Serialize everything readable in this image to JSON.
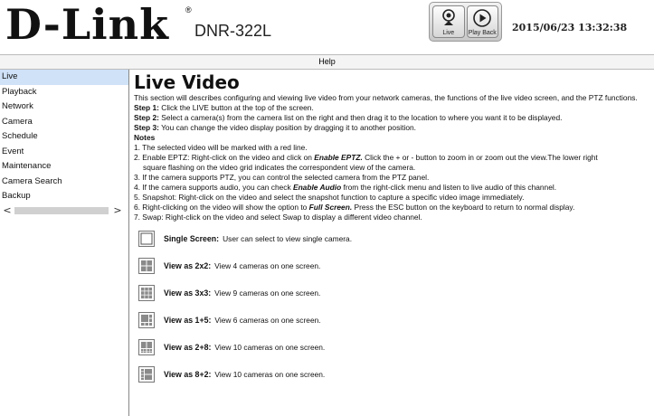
{
  "header": {
    "logo_text": "D-Link",
    "logo_reg": "®",
    "model": "DNR-322L",
    "live_label": "Live",
    "playback_label": "Play Back",
    "datetime": "2015/06/23 13:32:38"
  },
  "helpbar": {
    "label": "Help"
  },
  "sidebar": {
    "items": [
      {
        "label": "Live",
        "active": true
      },
      {
        "label": "Playback"
      },
      {
        "label": "Network"
      },
      {
        "label": "Camera"
      },
      {
        "label": "Schedule"
      },
      {
        "label": "Event"
      },
      {
        "label": "Maintenance"
      },
      {
        "label": "Camera Search"
      },
      {
        "label": "Backup"
      }
    ],
    "scroll_left": "<",
    "scroll_right": ">"
  },
  "content": {
    "title": "Live Video",
    "intro": "This section will describes configuring and viewing live video from your network cameras, the functions of the live video screen, and the PTZ functions.",
    "steps": [
      {
        "label": "Step 1:",
        "text": " Click the LIVE button at the top of the screen."
      },
      {
        "label": "Step 2:",
        "text": " Select a camera(s) from the camera list on the right and then drag it to the location to where you want it to be displayed."
      },
      {
        "label": "Step 3:",
        "text": " You can change the video display position by dragging it to another position."
      }
    ],
    "notes_title": "Notes",
    "notes": {
      "n1": "1. The selected video will be marked with a red line.",
      "n2_a": "2. Enable EPTZ: Right-click on the video and click on ",
      "n2_b": "Enable EPTZ.",
      "n2_c": " Click the + or - button to zoom in or zoom out the view.The lower right",
      "n2_d": "square flashing on the video grid indicates the correspondent view of the camera.",
      "n3": "3. If the camera supports PTZ, you can control the selected camera from the PTZ panel.",
      "n4_a": "4. If the camera supports audio, you can check ",
      "n4_b": "Enable Audio",
      "n4_c": " from the right-click menu and listen to live audio of this channel.",
      "n5": "5. Snapshot: Right-click on the video and select the snapshot function to capture a specific video image immediately.",
      "n6_a": "6. Right-clicking on the video will show the option to ",
      "n6_b": "Full Screen.",
      "n6_c": " Press the ESC button on the keyboard to return to normal display.",
      "n7": "7. Swap: Right-click on the video and select Swap to display a different video channel."
    },
    "views": [
      {
        "icon": "single-screen-icon",
        "label": "Single Screen:",
        "desc": "User can select to view single camera."
      },
      {
        "icon": "grid-2x2-icon",
        "label": "View as 2x2:",
        "desc": "View 4 cameras on one screen."
      },
      {
        "icon": "grid-3x3-icon",
        "label": "View as 3x3:",
        "desc": "View 9 cameras on one screen."
      },
      {
        "icon": "grid-1plus5-icon",
        "label": "View as 1+5:",
        "desc": "View 6 cameras on one screen."
      },
      {
        "icon": "grid-2plus8-icon",
        "label": "View as 2+8:",
        "desc": "View 10 cameras on one screen."
      },
      {
        "icon": "grid-8plus2-icon",
        "label": "View as 8+2:",
        "desc": "View 10 cameras on one screen."
      }
    ]
  }
}
